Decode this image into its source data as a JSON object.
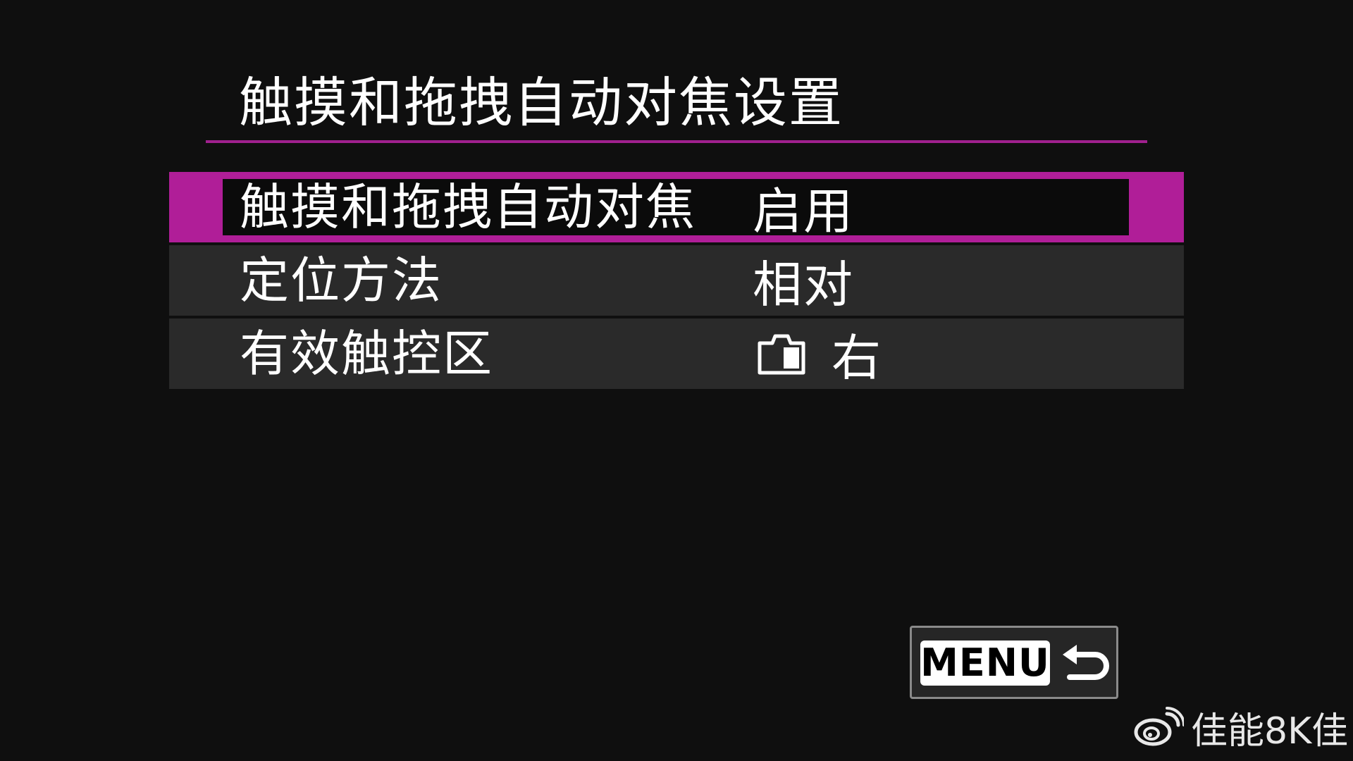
{
  "header": {
    "title": "触摸和拖拽自动对焦设置"
  },
  "menu": {
    "items": [
      {
        "label": "触摸和拖拽自动对焦",
        "value": "启用",
        "selected": true
      },
      {
        "label": "定位方法",
        "value": "相对",
        "selected": false
      },
      {
        "label": "有效触控区",
        "value": "右",
        "icon": "camera-body-icon",
        "selected": false
      }
    ]
  },
  "footer": {
    "menu_label": "MENU",
    "back_icon": "return-arrow-icon"
  },
  "watermark": {
    "icon": "weibo-icon",
    "text": "佳能8K佳"
  },
  "colors": {
    "background": "#0f0f0f",
    "row": "#2a2a2a",
    "accent": "#b01e98",
    "rule": "#a0208e"
  }
}
